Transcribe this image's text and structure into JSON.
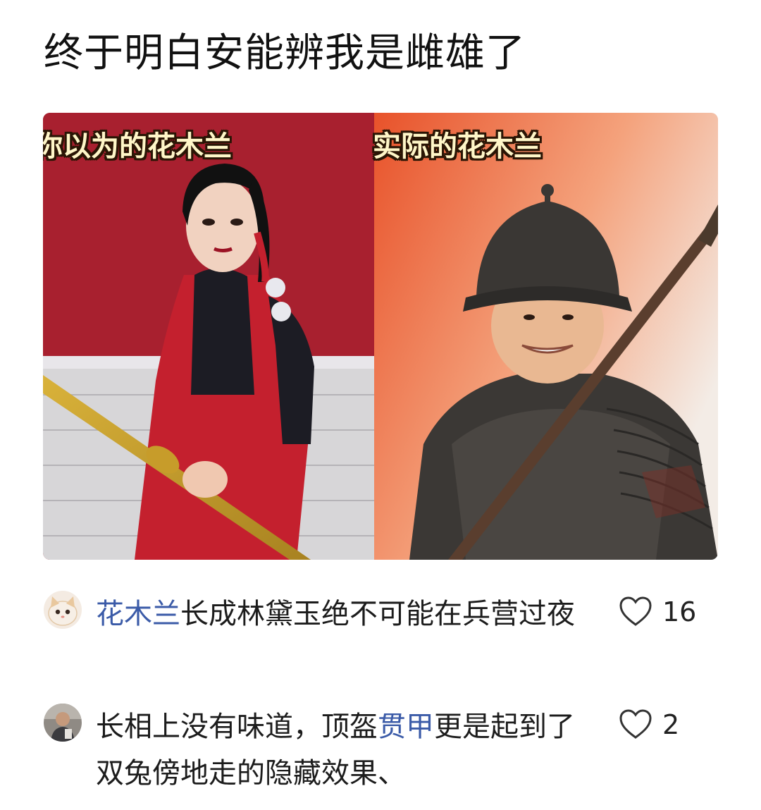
{
  "post": {
    "title": "终于明白安能辨我是雌雄了"
  },
  "image": {
    "caption_left": "你以为的花木兰",
    "caption_right": "实际的花木兰"
  },
  "comments": [
    {
      "highlight": "花木兰",
      "text_after": "长成林黛玉绝不可能在兵营过夜",
      "likes": "16",
      "avatar_icon": "cat-avatar",
      "like_icon": "heart-outline-icon"
    },
    {
      "text_before": "长相上没有味道，顶盔",
      "highlight": "贯甲",
      "text_after": "更是起到了双兔傍地走的隐藏效果、",
      "likes": "2",
      "avatar_icon": "person-avatar",
      "like_icon": "heart-outline-icon"
    }
  ],
  "colors": {
    "highlight": "#3b5ba8",
    "caption_text": "#fff6c8",
    "caption_outline": "#2a1505"
  }
}
